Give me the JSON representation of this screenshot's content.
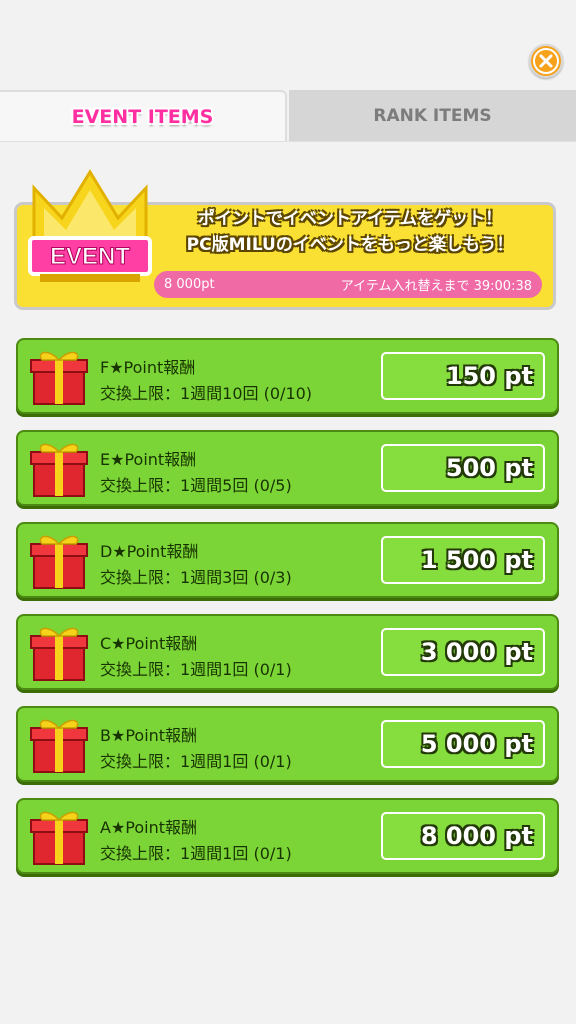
{
  "tabs": [
    {
      "label": "EVENT ITEMS",
      "active": true
    },
    {
      "label": "RANK ITEMS",
      "active": false
    }
  ],
  "banner": {
    "badge": "EVENT",
    "line1": "ポイントでイベントアイテムをゲット！",
    "line2": "PC版MILUのイベントをもっと楽しもう！",
    "points": "8 000pt",
    "timer_label": "アイテム入れ替えまで 39:00:38"
  },
  "items": [
    {
      "name": "F★Point報酬",
      "limit": "交換上限：1週間10回 (0/10)",
      "price": "150 pt"
    },
    {
      "name": "E★Point報酬",
      "limit": "交換上限：1週間5回 (0/5)",
      "price": "500 pt"
    },
    {
      "name": "D★Point報酬",
      "limit": "交換上限：1週間3回 (0/3)",
      "price": "1 500 pt"
    },
    {
      "name": "C★Point報酬",
      "limit": "交換上限：1週間1回 (0/1)",
      "price": "3 000 pt"
    },
    {
      "name": "B★Point報酬",
      "limit": "交換上限：1週間1回 (0/1)",
      "price": "5 000 pt"
    },
    {
      "name": "A★Point報酬",
      "limit": "交換上限：1週間1回 (0/1)",
      "price": "8 000 pt"
    }
  ],
  "colors": {
    "accent_pink": "#ff2fa2",
    "item_green": "#7cd537",
    "banner_yellow": "#f9e032",
    "close_orange": "#f7a21b"
  },
  "icons": {
    "close": "close-icon",
    "crown": "crown-icon",
    "gift": "gift-icon"
  }
}
